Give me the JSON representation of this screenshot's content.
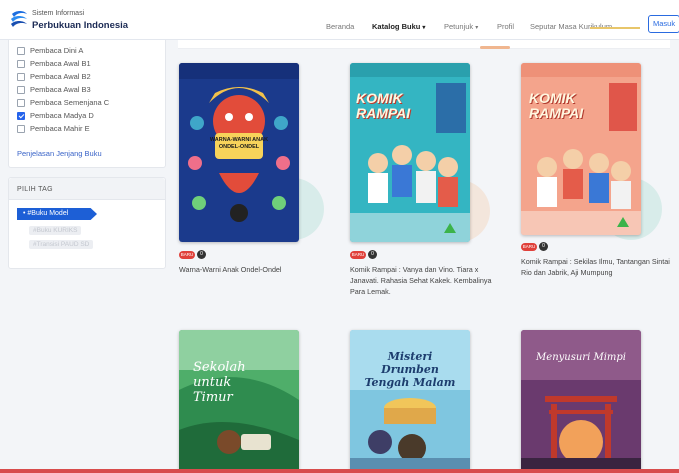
{
  "header": {
    "brand_top": "Sistem Informasi",
    "brand_main": "Perbukuan Indonesia",
    "nav": [
      {
        "label": "Beranda",
        "active": false,
        "dropdown": false
      },
      {
        "label": "Katalog Buku",
        "active": true,
        "dropdown": true
      },
      {
        "label": "Petunjuk",
        "active": false,
        "dropdown": true
      },
      {
        "label": "Profil",
        "active": false,
        "dropdown": false
      },
      {
        "label": "Seputar Masa Kurikulum",
        "active": false,
        "dropdown": false
      }
    ],
    "login_label": "Masuk",
    "accent_color": "#2a6be0"
  },
  "sidebar": {
    "levels": [
      {
        "label": "Pembaca Dini A",
        "checked": false
      },
      {
        "label": "Pembaca Awal B1",
        "checked": false
      },
      {
        "label": "Pembaca Awal B2",
        "checked": false
      },
      {
        "label": "Pembaca Awal B3",
        "checked": false
      },
      {
        "label": "Pembaca Semenjana C",
        "checked": false
      },
      {
        "label": "Pembaca Madya D",
        "checked": true
      },
      {
        "label": "Pembaca Mahir E",
        "checked": false
      }
    ],
    "level_link": "Penjelasan Jenjang Buku",
    "tag_title": "PILIH TAG",
    "tags": [
      {
        "label": "#Buku Model",
        "active": true
      },
      {
        "label": "#Buku KURIKS",
        "active": false
      },
      {
        "label": "#Transisi PAUD SD",
        "active": false
      }
    ]
  },
  "books": [
    {
      "title": "Warna-Warni Anak Ondel-Ondel",
      "cover_text": "WARNA-WARNI ANAK ONDEL-ONDEL",
      "badge": "BARU",
      "count": "0"
    },
    {
      "title": "Komik Rampai : Vanya dan Vino. Tiara x Janavati. Rahasia Sehat Kakek. Kembalinya Para Lemak.",
      "cover_text": "KOMIK RAMPAI",
      "badge": "BARU",
      "count": "0"
    },
    {
      "title": "Komik Rampai : Sekilas Ilmu, Tantangan Sintai Rio dan Jabrik, Aji Mumpung",
      "cover_text": "KOMIK RAMPAI",
      "badge": "BARU",
      "count": "0"
    },
    {
      "title": "",
      "cover_text": "Sekolah untuk Timur",
      "badge": "",
      "count": ""
    },
    {
      "title": "",
      "cover_text": "Misteri Drumben Tengah Malam",
      "badge": "",
      "count": ""
    },
    {
      "title": "",
      "cover_text": "Menyusuri Mimpi",
      "badge": "",
      "count": ""
    }
  ],
  "colors": {
    "checkbox_checked": "#2563eb",
    "badge_red": "#e0413b",
    "tag_active": "#1d5fd6"
  }
}
